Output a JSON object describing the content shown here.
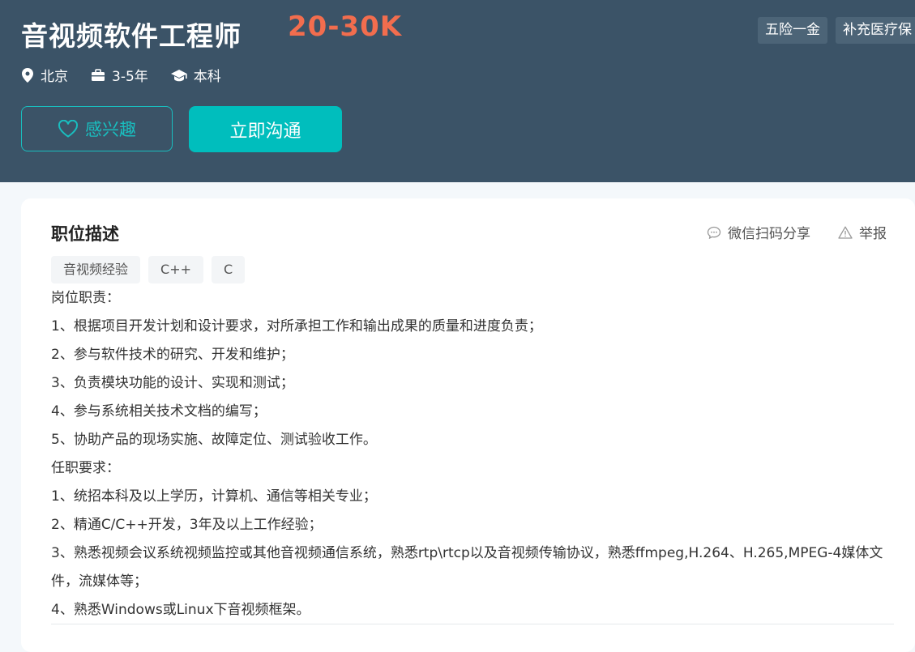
{
  "job": {
    "title": "音视频软件工程师",
    "salary": "20-30K",
    "benefits": [
      "五险一金",
      "补充医疗保"
    ],
    "meta": {
      "location": "北京",
      "experience": "3-5年",
      "education": "本科"
    }
  },
  "buttons": {
    "interest": "感兴趣",
    "chat": "立即沟通"
  },
  "description": {
    "title": "职位描述",
    "share_label": "微信扫码分享",
    "report_label": "举报",
    "skills": [
      "音视频经验",
      "C++",
      "C"
    ],
    "lines": [
      "岗位职责：",
      "1、根据项目开发计划和设计要求，对所承担工作和输出成果的质量和进度负责；",
      "2、参与软件技术的研究、开发和维护；",
      "3、负责模块功能的设计、实现和测试；",
      "4、参与系统相关技术文档的编写；",
      "5、协助产品的现场实施、故障定位、测试验收工作。",
      "任职要求：",
      "1、统招本科及以上学历，计算机、通信等相关专业；",
      "2、精通C/C++开发，3年及以上工作经验；",
      "3、熟悉视频会议系统视频监控或其他音视频通信系统，熟悉rtp\\rtcp以及音视频传输协议，熟悉ffmpeg,H.264、H.265,MPEG-4媒体文件，流媒体等；",
      "4、熟悉Windows或Linux下音视频框架。"
    ]
  },
  "colors": {
    "hero_bg": "#3b5367",
    "salary": "#f26d4e",
    "accent": "#00bebd"
  }
}
